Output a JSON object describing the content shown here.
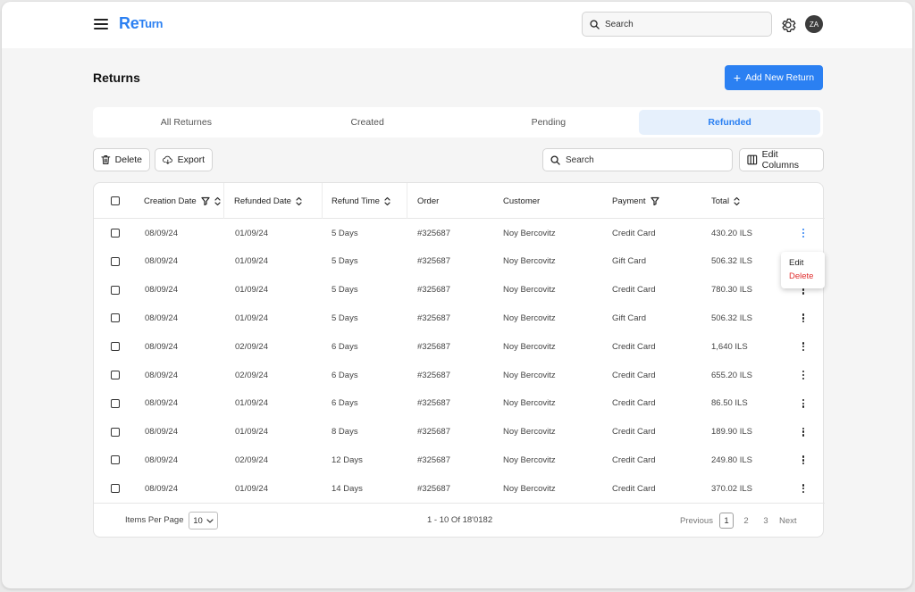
{
  "app": {
    "logo_main": "Re",
    "logo_small": "Turn",
    "search_placeholder": "Search",
    "avatar_initials": "ZA"
  },
  "page": {
    "title": "Returns",
    "add_button_label": "Add New Return"
  },
  "tabs": [
    {
      "label": "All Returnes",
      "active": false
    },
    {
      "label": "Created",
      "active": false
    },
    {
      "label": "Pending",
      "active": false
    },
    {
      "label": "Refunded",
      "active": true
    }
  ],
  "toolbar": {
    "delete_label": "Delete",
    "export_label": "Export",
    "search_placeholder": "Search",
    "edit_columns_label": "Edit Columns"
  },
  "table": {
    "headers": [
      "Creation Date",
      "Refunded Date",
      "Refund Time",
      "Order",
      "Customer",
      "Payment",
      "Total"
    ],
    "rows": [
      [
        "08/09/24",
        "01/09/24",
        "5 Days",
        "#325687",
        "Noy Bercovitz",
        "Credit Card",
        "430.20 ILS"
      ],
      [
        "08/09/24",
        "01/09/24",
        "5 Days",
        "#325687",
        "Noy Bercovitz",
        "Gift Card",
        "506.32 ILS"
      ],
      [
        "08/09/24",
        "01/09/24",
        "5 Days",
        "#325687",
        "Noy Bercovitz",
        "Credit Card",
        "780.30 ILS"
      ],
      [
        "08/09/24",
        "01/09/24",
        "5 Days",
        "#325687",
        "Noy Bercovitz",
        "Gift Card",
        "506.32 ILS"
      ],
      [
        "08/09/24",
        "02/09/24",
        "6 Days",
        "#325687",
        "Noy Bercovitz",
        "Credit Card",
        "1,640 ILS"
      ],
      [
        "08/09/24",
        "02/09/24",
        "6 Days",
        "#325687",
        "Noy Bercovitz",
        "Credit Card",
        "655.20 ILS"
      ],
      [
        "08/09/24",
        "01/09/24",
        "6 Days",
        "#325687",
        "Noy Bercovitz",
        "Credit Card",
        "86.50 ILS"
      ],
      [
        "08/09/24",
        "01/09/24",
        "8 Days",
        "#325687",
        "Noy Bercovitz",
        "Credit Card",
        "189.90 ILS"
      ],
      [
        "08/09/24",
        "02/09/24",
        "12 Days",
        "#325687",
        "Noy Bercovitz",
        "Credit Card",
        "249.80 ILS"
      ],
      [
        "08/09/24",
        "01/09/24",
        "14 Days",
        "#325687",
        "Noy Bercovitz",
        "Credit Card",
        "370.02 ILS"
      ]
    ],
    "row_menu": {
      "edit_label": "Edit",
      "delete_label": "Delete"
    }
  },
  "footer": {
    "items_per_page_label": "Items Per Page",
    "items_per_page_value": "10",
    "range_text": "1 - 10 Of 18'0182",
    "previous_label": "Previous",
    "pages": [
      "1",
      "2",
      "3"
    ],
    "current_page": "1",
    "next_label": "Next"
  },
  "colors": {
    "accent": "#2b80f2",
    "danger": "#e02d2d",
    "tab_active_bg": "#e6f0fc"
  }
}
